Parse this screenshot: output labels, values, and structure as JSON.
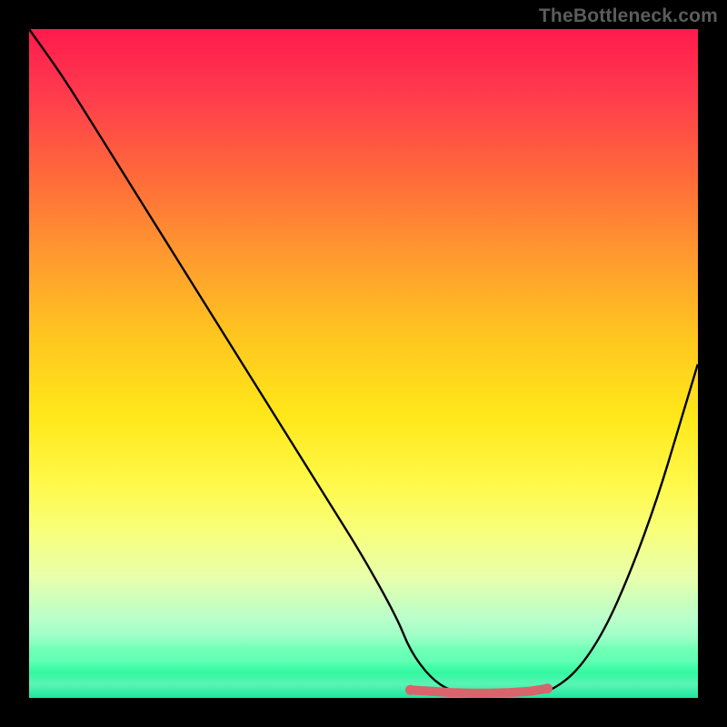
{
  "watermark": "TheBottleneck.com",
  "chart_data": {
    "type": "line",
    "title": "",
    "xlabel": "",
    "ylabel": "",
    "xlim": [
      0,
      100
    ],
    "ylim": [
      0,
      100
    ],
    "grid": false,
    "legend": false,
    "curve_color": "#000000",
    "marker_color": "#d9646b",
    "x": [
      0,
      5,
      10,
      15,
      20,
      25,
      30,
      35,
      40,
      45,
      50,
      55,
      57,
      60,
      63,
      66,
      69,
      72,
      75,
      78,
      82,
      86,
      90,
      94,
      97,
      100
    ],
    "y": [
      100,
      93,
      85,
      77,
      69,
      61,
      53,
      45,
      37,
      29,
      21,
      12,
      7,
      3,
      1,
      0.5,
      0.5,
      0.5,
      0.5,
      1,
      4,
      10,
      19,
      30,
      40,
      50
    ],
    "markers_x": [
      57,
      60,
      63,
      66,
      69,
      72,
      75,
      77.5
    ],
    "markers_y": [
      1.2,
      1.0,
      0.8,
      0.7,
      0.7,
      0.8,
      1.0,
      1.4
    ]
  }
}
